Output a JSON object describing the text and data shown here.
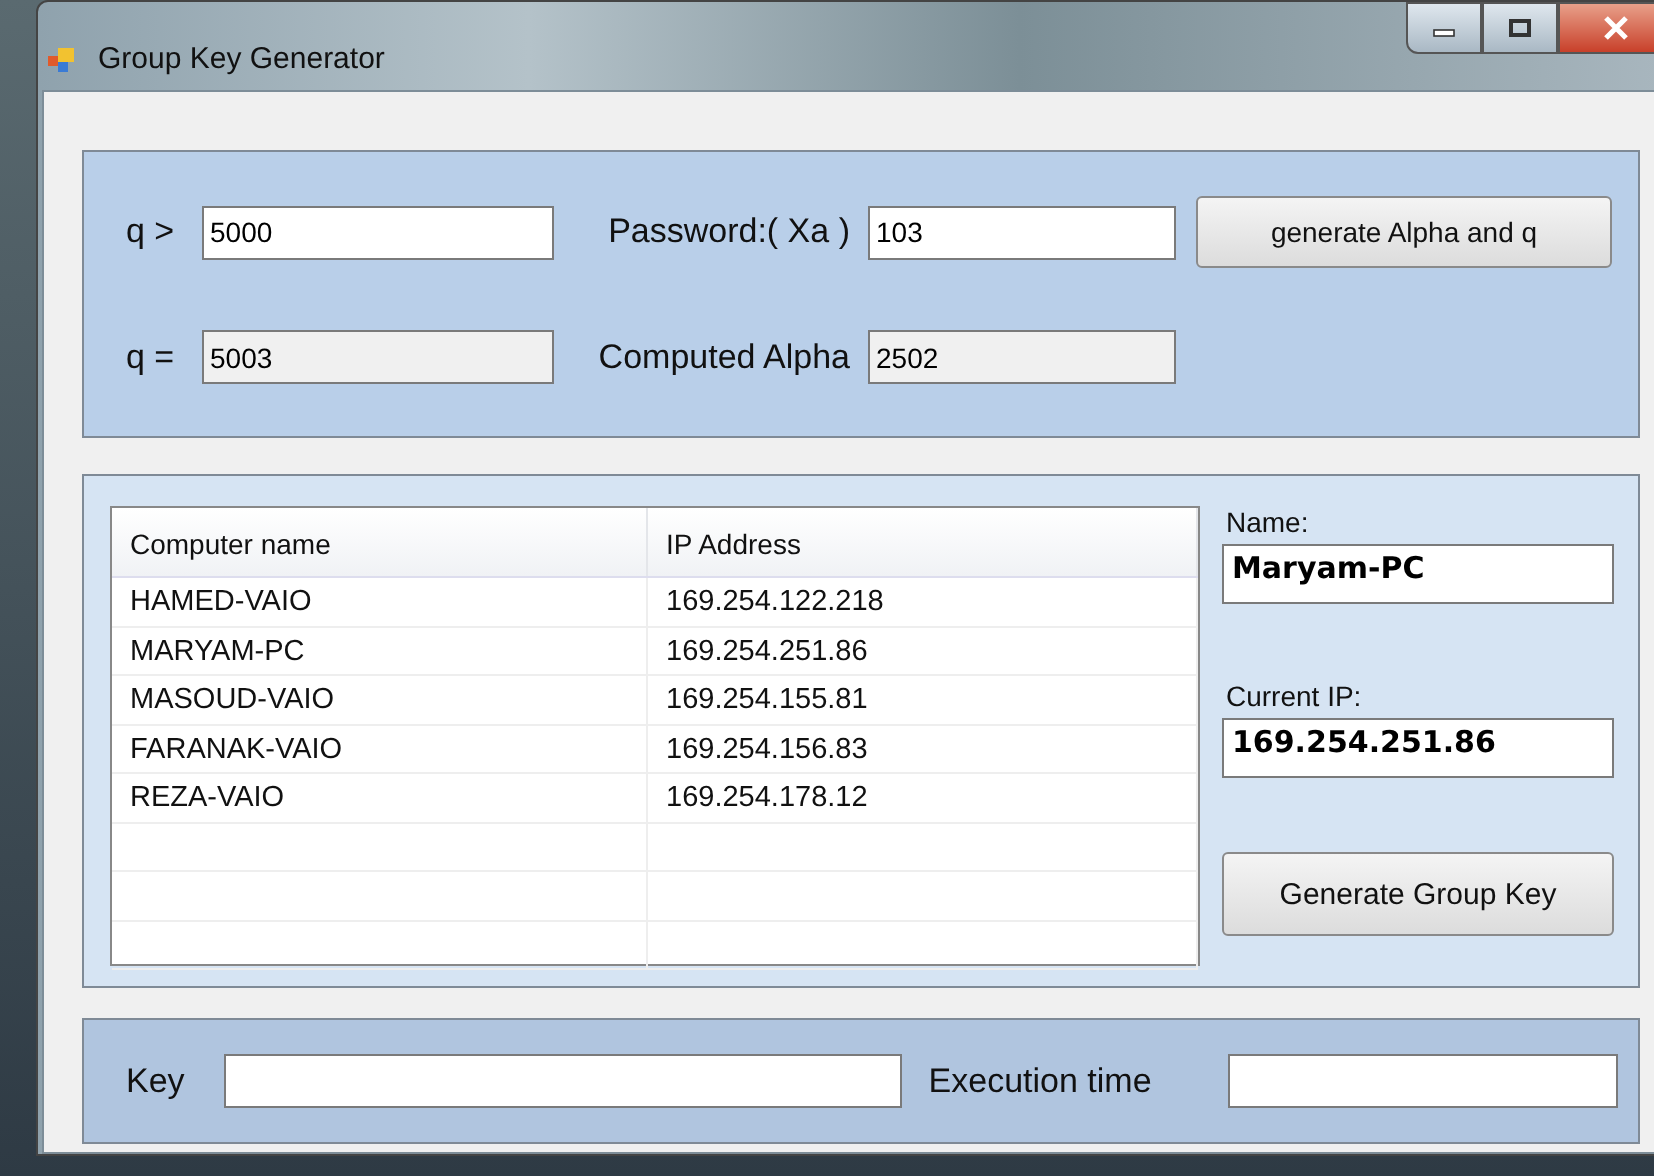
{
  "window": {
    "title": "Group Key Generator"
  },
  "top_panel": {
    "rows": [
      {
        "label": "q >",
        "field": {
          "value": "5000",
          "readonly": false
        },
        "label2": "Password:( Xa )",
        "field2": {
          "value": "103",
          "readonly": false
        },
        "button": "generate Alpha and q"
      },
      {
        "label": "q =",
        "field": {
          "value": "5003",
          "readonly": true
        },
        "label2": "Computed Alpha",
        "field2": {
          "value": "2502",
          "readonly": true
        }
      }
    ]
  },
  "table": {
    "columns": [
      "Computer name",
      "IP Address"
    ],
    "rows": [
      [
        "HAMED-VAIO",
        "169.254.122.218"
      ],
      [
        "MARYAM-PC",
        "169.254.251.86"
      ],
      [
        "MASOUD-VAIO",
        "169.254.155.81"
      ],
      [
        "FARANAK-VAIO",
        "169.254.156.83"
      ],
      [
        "REZA-VAIO",
        "169.254.178.12"
      ]
    ]
  },
  "side": {
    "name_label": "Name:",
    "name_value": "Maryam-PC",
    "ip_label": "Current IP:",
    "ip_value": "169.254.251.86",
    "button": "Generate Group Key"
  },
  "bottom_panel": {
    "key_label": "Key",
    "time_label": "Execution time"
  }
}
